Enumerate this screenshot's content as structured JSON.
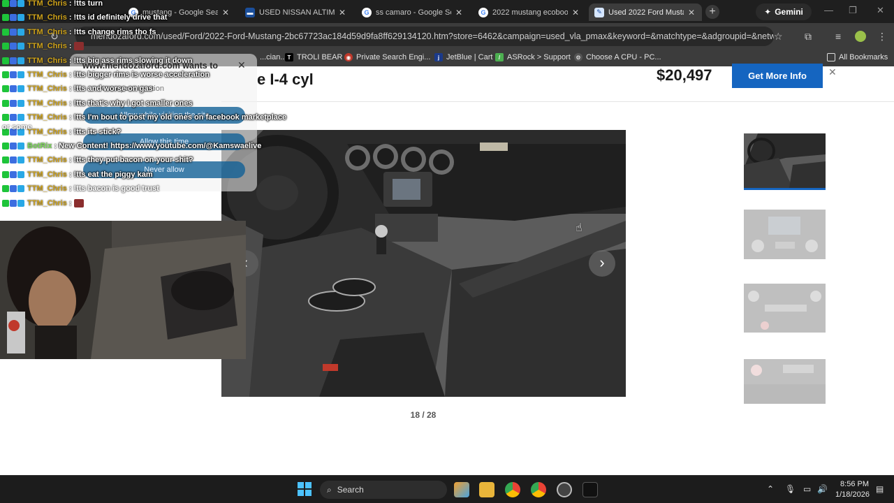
{
  "tabs": [
    {
      "label": "mustang - Google Sear",
      "favicon": "google",
      "active": false
    },
    {
      "label": "USED NISSAN ALTIMA 2",
      "favicon": "car-site",
      "active": false
    },
    {
      "label": "ss camaro - Google Sear",
      "favicon": "google",
      "active": false
    },
    {
      "label": "2022 mustang ecoboost",
      "favicon": "google",
      "active": false
    },
    {
      "label": "Used 2022 Ford Mustan",
      "favicon": "dealer",
      "active": true
    }
  ],
  "gemini_label": "Gemini",
  "address_url": "mendozaford.com/used/Ford/2022-Ford-Mustang-2bc67723ac184d59d9fa8ff629134120.htm?store=6462&campaign=used_vla_pmax&keyword=&matchtype=&adgroupid=&network=x...",
  "bookmarks": [
    {
      "label": "...cian...",
      "icon": "generic"
    },
    {
      "label": "TROLI BEAR",
      "icon": "tiktok"
    },
    {
      "label": "Private Search Engi...",
      "icon": "ghost"
    },
    {
      "label": "JetBlue | Cart",
      "icon": "jetblue"
    },
    {
      "label": "ASRock > Support",
      "icon": "asrock"
    },
    {
      "label": "Choose A CPU - PC...",
      "icon": "pc"
    },
    {
      "label": "All Bookmarks",
      "icon": "folder"
    }
  ],
  "listing": {
    "title": "e I-4 cyl",
    "price": "$20,497",
    "cta_label": "Get More Info",
    "photo_counter": "18 / 28"
  },
  "permission_popup": {
    "title": "www.mendozaford.com wants to",
    "subtitle": "Know your location",
    "btn_allow_visit": "Allow while visiting the site",
    "btn_allow_once": "Allow this time",
    "btn_never": "Never allow"
  },
  "chat": [
    {
      "user": "TTM_Chris",
      "msg": "!tts turn",
      "bot": false
    },
    {
      "user": "TTM_Chris",
      "msg": "!tts id definitely drive that",
      "bot": false
    },
    {
      "user": "TTM_Chris",
      "msg": "!tts change rims tho fs",
      "bot": false
    },
    {
      "user": "TTM_Chris",
      "msg": "",
      "bot": false,
      "emote": true
    },
    {
      "user": "TTM_Chris",
      "msg": "!tts big ass rims slowing it down",
      "bot": false
    },
    {
      "user": "TTM_Chris",
      "msg": "!tts bigger rims is worse acceleration",
      "bot": false
    },
    {
      "user": "TTM_Chris",
      "msg": "!tts and worse on gas",
      "bot": false
    },
    {
      "user": "TTM_Chris",
      "msg": "!tts that's why I got smaller ones",
      "bot": false
    },
    {
      "user": "TTM_Chris",
      "msg": "!tts I'm bout to post my old ones on facebook marketplace",
      "bot": false
    },
    {
      "user": "TTM_Chris",
      "msg": "!tts its stick?",
      "bot": false
    },
    {
      "user": "BotRix",
      "msg": "New Content! https://www.youtube.com/@Kamswaelive",
      "bot": true
    },
    {
      "user": "TTM_Chris",
      "msg": "!tts they put bacon on your shit?",
      "bot": false
    },
    {
      "user": "TTM_Chris",
      "msg": "!tts eat the piggy kam",
      "bot": false
    },
    {
      "user": "TTM_Chris",
      "msg": "!tts bacon is good trust",
      "bot": false,
      "faded": true
    },
    {
      "user": "TTM_Chris",
      "msg": "",
      "bot": false,
      "emote": true
    }
  ],
  "chat_wrap_text": "or some",
  "taskbar": {
    "search_label": "Search",
    "time": "8:56 PM",
    "date": "1/18/2026"
  },
  "colors": {
    "accent_blue": "#1565c0",
    "chat_user": "#cfa31b",
    "bot_user": "#7ad957"
  }
}
